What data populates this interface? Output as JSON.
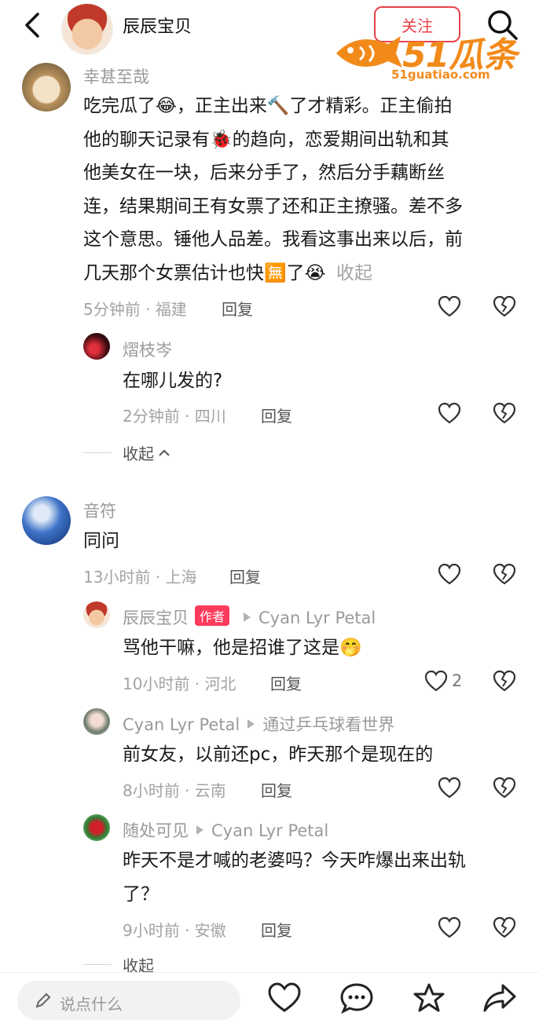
{
  "header": {
    "username": "辰辰宝贝",
    "follow_label": "关注"
  },
  "watermark": {
    "brand": "51瓜条",
    "site": "51guatiao.com"
  },
  "comments": [
    {
      "user": "幸甚至哉",
      "text_lines": [
        "吃完瓜了😂，正主出来🔨了才精彩。正主偷拍",
        "他的聊天记录有🐞的趋向，恋爱期间出轨和其",
        "他美女在一块，后来分手了，然后分手藕断丝",
        "连，结果期间王有女票了还和正主撩骚。差不多",
        "这个意思。锤他人品差。我看这事出来以后，前",
        "几天那个女票估计也快🈚了😭"
      ],
      "expand_label": "收起",
      "time_loc": "5分钟前 · 福建",
      "reply_label": "回复",
      "replies": [
        {
          "user": "熠枝岑",
          "text": "在哪儿发的?",
          "time_loc": "2分钟前 · 四川",
          "reply_label": "回复"
        }
      ],
      "collapse_label": "收起"
    },
    {
      "user": "音符",
      "text": "同问",
      "time_loc": "13小时前 · 上海",
      "reply_label": "回复",
      "replies": [
        {
          "user": "辰辰宝贝",
          "badge": "作者",
          "reply_to": "Cyan Lyr Petal",
          "text": "骂他干嘛，他是招谁了这是🤭",
          "time_loc": "10小时前 · 河北",
          "reply_label": "回复",
          "likes": "2"
        },
        {
          "user": "Cyan Lyr Petal",
          "reply_to": "通过乒乓球看世界",
          "text": "前女友，以前还pc，昨天那个是现在的",
          "time_loc": "8小时前 · 云南",
          "reply_label": "回复"
        },
        {
          "user": "随处可见",
          "reply_to": "Cyan Lyr Petal",
          "text_lines": [
            "昨天不是才喊的老婆吗？今天咋爆出来出轨",
            "了？"
          ],
          "time_loc": "9小时前 · 安徽",
          "reply_label": "回复"
        }
      ],
      "collapse_label": "收起"
    }
  ],
  "bottom": {
    "input_placeholder": "说点什么"
  },
  "colors": {
    "accent": "#e8434a",
    "badge": "#ff3b5c",
    "watermark": "#f28a1a"
  }
}
